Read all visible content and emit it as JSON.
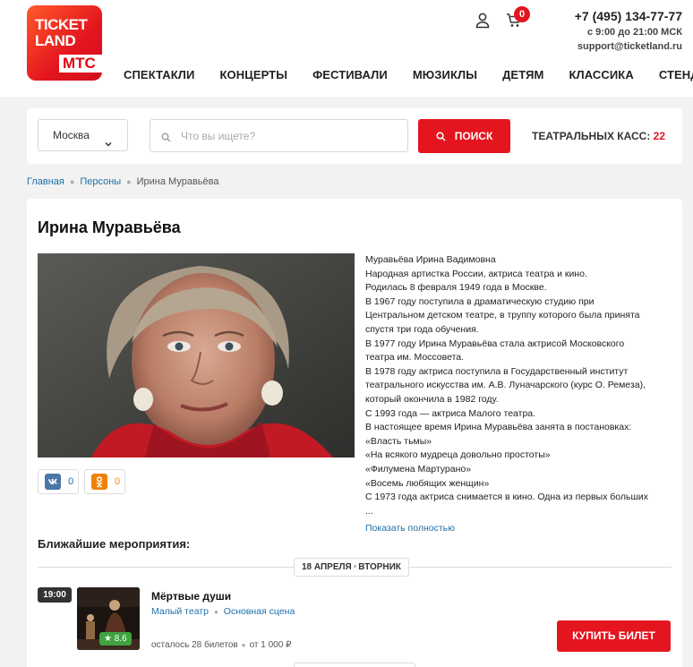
{
  "brand": {
    "logo_line1": "TICKET",
    "logo_line2": "LAND",
    "logo_line3": "МТС",
    "accent_color": "#e4151f"
  },
  "header": {
    "cart_count": "0",
    "phone": "+7 (495) 134-77-77",
    "hours": "с 9:00 до 21:00 МСК",
    "email": "support@ticketland.ru",
    "icons": [
      "user-icon",
      "cart-icon"
    ]
  },
  "nav": {
    "items": [
      "СПЕКТАКЛИ",
      "КОНЦЕРТЫ",
      "ФЕСТИВАЛИ",
      "МЮЗИКЛЫ",
      "ДЕТЯМ",
      "КЛАССИКА",
      "СТЕНДАП"
    ]
  },
  "search": {
    "city": "Москва",
    "placeholder": "Что вы ищете?",
    "button": "ПОИСК",
    "kass_label": "ТЕАТРАЛЬНЫХ КАСС:",
    "kass_count": "22"
  },
  "breadcrumb": {
    "items": [
      "Главная",
      "Персоны"
    ],
    "current": "Ирина Муравьёва"
  },
  "person": {
    "name": "Ирина Муравьёва",
    "share": {
      "vk_count": "0",
      "ok_count": "0"
    },
    "bio_lines": [
      "Муравьёва Ирина Вадимовна",
      "Народная артистка России, актриса театра и кино.",
      "Родилась 8 февраля 1949 года в Москве.",
      "В 1967 году поступила в драматическую студию при",
      "Центральном детском театре, в труппу которого была принята",
      "спустя три года обучения.",
      "В 1977 году Ирина Муравьёва стала актрисой Московского",
      "театра им. Моссовета.",
      "В 1978 году актриса поступила в Государственный институт",
      "театрального искусства им. А.В. Луначарского (курс О. Ремеза),",
      "который окончила в 1982 году.",
      "С 1993 года — актриса Малого театра.",
      "В настоящее время Ирина Муравьёва занята в постановках:",
      "«Власть тьмы»",
      "«На всякого мудреца довольно простоты»",
      "«Филумена Мартурано»",
      "«Восемь любящих женщин»",
      "С 1973 года актриса снимается в кино. Одна из первых больших",
      "..."
    ],
    "show_more": "Показать полностью"
  },
  "events": {
    "title": "Ближайшие мероприятия:",
    "date": "18 АПРЕЛЯ",
    "weekday": "ВТОРНИК",
    "items": [
      {
        "time": "19:00",
        "rating": "8.6",
        "title": "Мёртвые души",
        "venue": "Малый театр",
        "stage": "Основная сцена",
        "tickets_left": "осталось 28 билетов",
        "price": "от 1 000 ₽",
        "buy_label": "КУПИТЬ БИЛЕТ"
      }
    ]
  }
}
